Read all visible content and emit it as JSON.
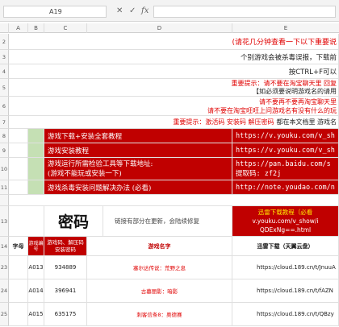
{
  "formula_bar": {
    "cell_ref": "A19",
    "cancel_icon": "✕",
    "confirm_icon": "✓",
    "fx": "fx"
  },
  "columns": [
    "A",
    "B",
    "C",
    "D",
    "E"
  ],
  "rows": {
    "r2": {
      "num": "2",
      "text": "(请花几分钟查看一下以下重要说"
    },
    "r3": {
      "num": "3",
      "text": "个别游戏会被杀毒误报，下载前"
    },
    "r4": {
      "num": "4",
      "text": "按CTRL+F可以"
    },
    "r5": {
      "num": "5",
      "line1": "重要提示：请不要在淘宝聊天里 回复",
      "line2": "【如必须要说明游戏名的请用"
    },
    "r6": {
      "num": "6",
      "line1": "请不要再不要再淘宝聊天里",
      "line2": "请不要在淘宝旺旺上问游戏名有没有什么的玩"
    },
    "r7": {
      "num": "7",
      "red_part": "重要提示：激活码 安装码 解压密码",
      "black_part": "都在本文档里 游戏名"
    },
    "r8": {
      "num": "8",
      "title": "游戏下载+安装全套教程",
      "link": "https://v.youku.com/v_sh"
    },
    "r9": {
      "num": "9",
      "title": "游戏安装教程",
      "link": "https://v.youku.com/v_sh"
    },
    "r10": {
      "num": "10",
      "title_line1": "游戏运行所需检验工具等下载地址:",
      "title_line2": "(游戏不能玩或安装一下)",
      "link_line1": "https://pan.baidu.com/s",
      "link_line2": "提取码: zf2j"
    },
    "r11": {
      "num": "11",
      "title": "游戏杀毒安装问题解决办法 (必看)",
      "link": "http://note.youdao.com/n"
    },
    "r13": {
      "num": "13",
      "big": "密码",
      "note": "链接有部分在更新，会陆续修复",
      "right_line1": "迅雷下载教程（必看",
      "right_line2": "v.youku.com/v_show/i",
      "right_line3": "QDExNg==.html"
    }
  },
  "table_header": {
    "num": "14",
    "col_a": "字母",
    "col_b": "游戏编号",
    "col_c_line1": "游戏码、解压码",
    "col_c_line2": "安装密码",
    "col_d": "游戏名字",
    "col_e": "迅雷下载（天翼云盘）"
  },
  "games": [
    {
      "row": "23",
      "id": "A013",
      "code": "934889",
      "name": "塞尔达传说：荒野之息",
      "link": "https://cloud.189.cn/t/JnuuA"
    },
    {
      "row": "24",
      "id": "A014",
      "code": "396941",
      "name": "古墓丽影：暗影",
      "link": "https://cloud.189.cn/t/fAZN"
    },
    {
      "row": "25",
      "id": "A015",
      "code": "635175",
      "name": "刺客信条8：奥德赛",
      "link": "https://cloud.189.cn/t/QBzy"
    }
  ]
}
